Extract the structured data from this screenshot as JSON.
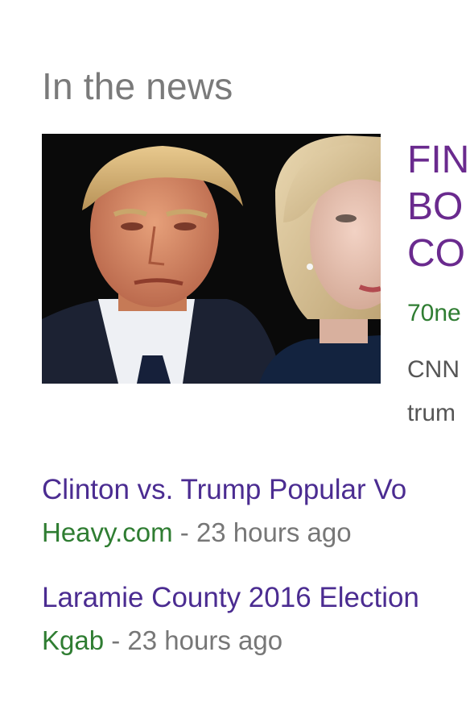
{
  "section": {
    "title": "In the news"
  },
  "top_story": {
    "headline_lines": "FIN\nBO\nCO",
    "source_url": "70ne",
    "snippet_lines": "CNN\ntrum",
    "image_alt": "Donald Trump and Hillary Clinton"
  },
  "news_items": [
    {
      "title": "Clinton vs. Trump Popular Vo",
      "source": "Heavy.com",
      "separator": " - ",
      "time": "23 hours ago"
    },
    {
      "title": "Laramie County 2016 Election",
      "source": "Kgab",
      "separator": " - ",
      "time": "23 hours ago"
    }
  ],
  "colors": {
    "section_title": "#7a7a7a",
    "headline": "#6a2a8e",
    "link": "#4b2c91",
    "source": "#2f7d32",
    "meta": "#777777"
  }
}
